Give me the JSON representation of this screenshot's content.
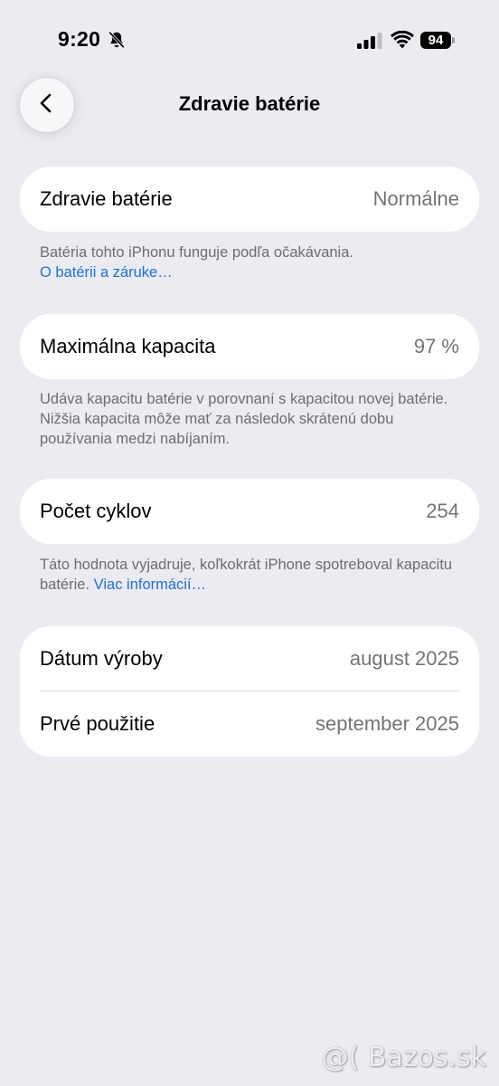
{
  "status_bar": {
    "time": "9:20",
    "battery_level": "94",
    "icons": [
      "bell-slash-icon",
      "cellular-signal-icon",
      "wifi-icon",
      "battery-icon"
    ]
  },
  "nav": {
    "back_icon": "chevron-left-icon",
    "title": "Zdravie batérie"
  },
  "health": {
    "label": "Zdravie batérie",
    "value": "Normálne",
    "footer_text": "Batéria tohto iPhonu funguje podľa očakávania.",
    "footer_link": "O batérii a záruke…"
  },
  "capacity": {
    "label": "Maximálna kapacita",
    "value": "97 %",
    "footer_text": "Udáva kapacitu batérie v porovnaní s kapacitou novej batérie. Nižšia kapacita môže mať za následok skrátenú dobu používania medzi nabíjaním."
  },
  "cycles": {
    "label": "Počet cyklov",
    "value": "254",
    "footer_text": "Táto hodnota vyjadruje, koľkokrát iPhone spotreboval kapacitu batérie.",
    "footer_link": "Viac informácií…"
  },
  "dates": {
    "manufacture_label": "Dátum výroby",
    "manufacture_value": "august 2025",
    "first_use_label": "Prvé použitie",
    "first_use_value": "september 2025"
  },
  "watermark": "@( Bazos.sk",
  "colors": {
    "background": "#ebebf1",
    "link": "#1f6fd6",
    "secondary_text": "#6d6d72"
  }
}
